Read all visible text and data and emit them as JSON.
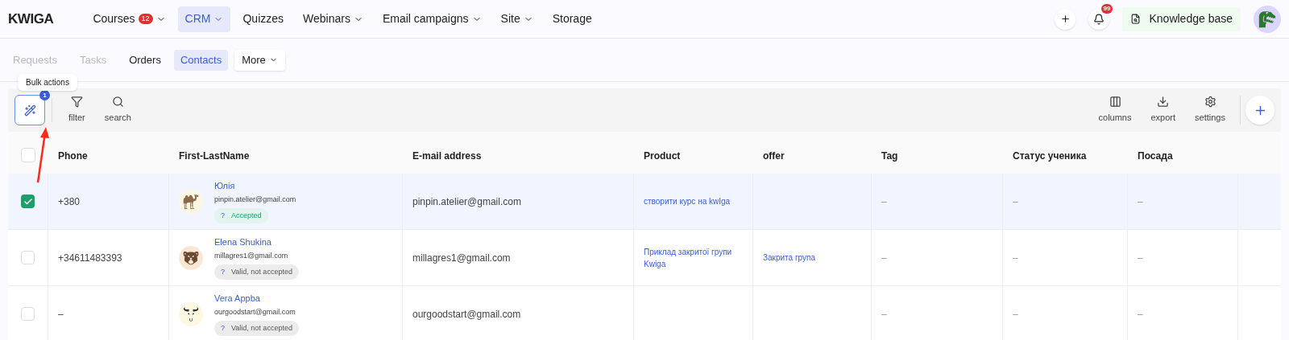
{
  "logo": "KWIGA",
  "nav": [
    {
      "label": "Courses",
      "badge": "12",
      "dropdown": true,
      "selected": false
    },
    {
      "label": "CRM",
      "dropdown": true,
      "selected": true
    },
    {
      "label": "Quizzes",
      "dropdown": false,
      "selected": false
    },
    {
      "label": "Webinars",
      "dropdown": true,
      "selected": false
    },
    {
      "label": "Email campaigns",
      "dropdown": true,
      "selected": false
    },
    {
      "label": "Site",
      "dropdown": true,
      "selected": false
    },
    {
      "label": "Storage",
      "dropdown": false,
      "selected": false
    }
  ],
  "notifications": {
    "count": "99"
  },
  "knowledge_base": "Knowledge base",
  "subnav": [
    {
      "label": "Requests",
      "disabled": true,
      "selected": false
    },
    {
      "label": "Tasks",
      "disabled": true,
      "selected": false
    },
    {
      "label": "Orders",
      "disabled": false,
      "selected": false
    },
    {
      "label": "Contacts",
      "disabled": false,
      "selected": true
    }
  ],
  "more": "More",
  "tooltip": "Bulk actions",
  "bulk_count": "1",
  "toolbar_left": [
    "filter",
    "search"
  ],
  "toolbar_right": [
    "columns",
    "export",
    "settings"
  ],
  "table": {
    "columns": [
      "Phone",
      "First-LastName",
      "E-mail address",
      "Product",
      "offer",
      "Tag",
      "Статус ученика",
      "Посада"
    ],
    "select_all_checked": false,
    "rows": [
      {
        "checked": true,
        "phone": "+380",
        "name": "Юлія",
        "email_small": "pinpin.atelier@gmail.com",
        "status_icon": "?",
        "status": "Accepted",
        "accepted": true,
        "email": "pinpin.atelier@gmail.com",
        "product": "створити курс на kwIga",
        "tag": "–",
        "student_status": "–",
        "position": "–"
      },
      {
        "checked": false,
        "phone": "+34611483393",
        "name": "Elena Shukina",
        "email_small": "millagres1@gmail.com",
        "status_icon": "?",
        "status": "Valid, not accepted",
        "accepted": false,
        "email": "millagres1@gmail.com",
        "product": "Приклад закритої групи Kwiga",
        "offer": "Закрита група",
        "tag": "–",
        "student_status": "–",
        "position": "–"
      },
      {
        "checked": false,
        "phone": "–",
        "name": "Vera Appba",
        "email_small": "ourgoodstart@gmail.com",
        "status_icon": "?",
        "status": "Valid, not accepted",
        "accepted": false,
        "email": "ourgoodstart@gmail.com",
        "tag": "–",
        "student_status": "–",
        "position": "–"
      }
    ]
  }
}
